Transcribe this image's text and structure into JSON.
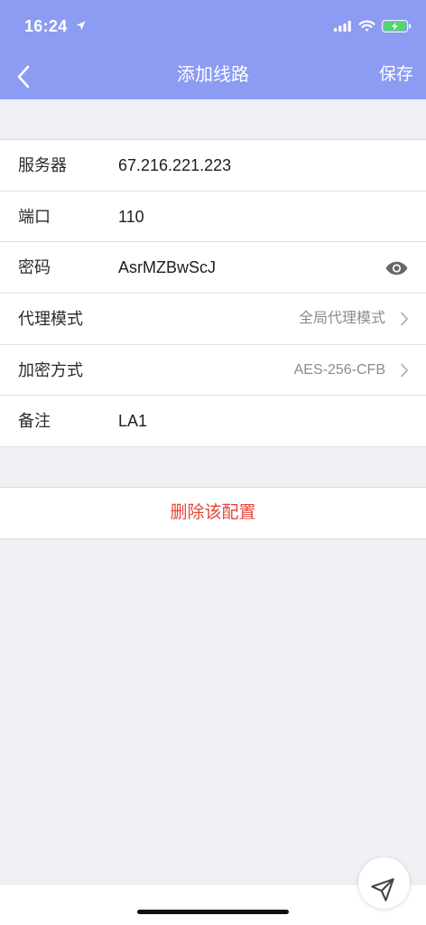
{
  "status_bar": {
    "time": "16:24",
    "icons": [
      "location-arrow-icon",
      "signal-icon",
      "wifi-icon",
      "battery-charging-icon"
    ]
  },
  "nav": {
    "back_icon": "back-chevron-icon",
    "title": "添加线路",
    "save_label": "保存"
  },
  "form": {
    "server": {
      "label": "服务器",
      "value": "67.216.221.223"
    },
    "port": {
      "label": "端口",
      "value": "110"
    },
    "password": {
      "label": "密码",
      "value": "AsrMZBwScJ",
      "toggle_icon": "eye-icon"
    },
    "proxy_mode": {
      "label": "代理模式",
      "value": "全局代理模式",
      "icon": "chevron-right-icon"
    },
    "encryption": {
      "label": "加密方式",
      "value": "AES-256-CFB",
      "icon": "chevron-right-icon"
    },
    "remark": {
      "label": "备注",
      "value": "LA1"
    }
  },
  "delete_label": "删除该配置",
  "floating_button": {
    "icon": "send-icon"
  },
  "colors": {
    "nav_background": "#8c9cf2",
    "page_background": "#efeff4",
    "delete_text": "#e4453a",
    "battery_fill": "#4cd964"
  }
}
